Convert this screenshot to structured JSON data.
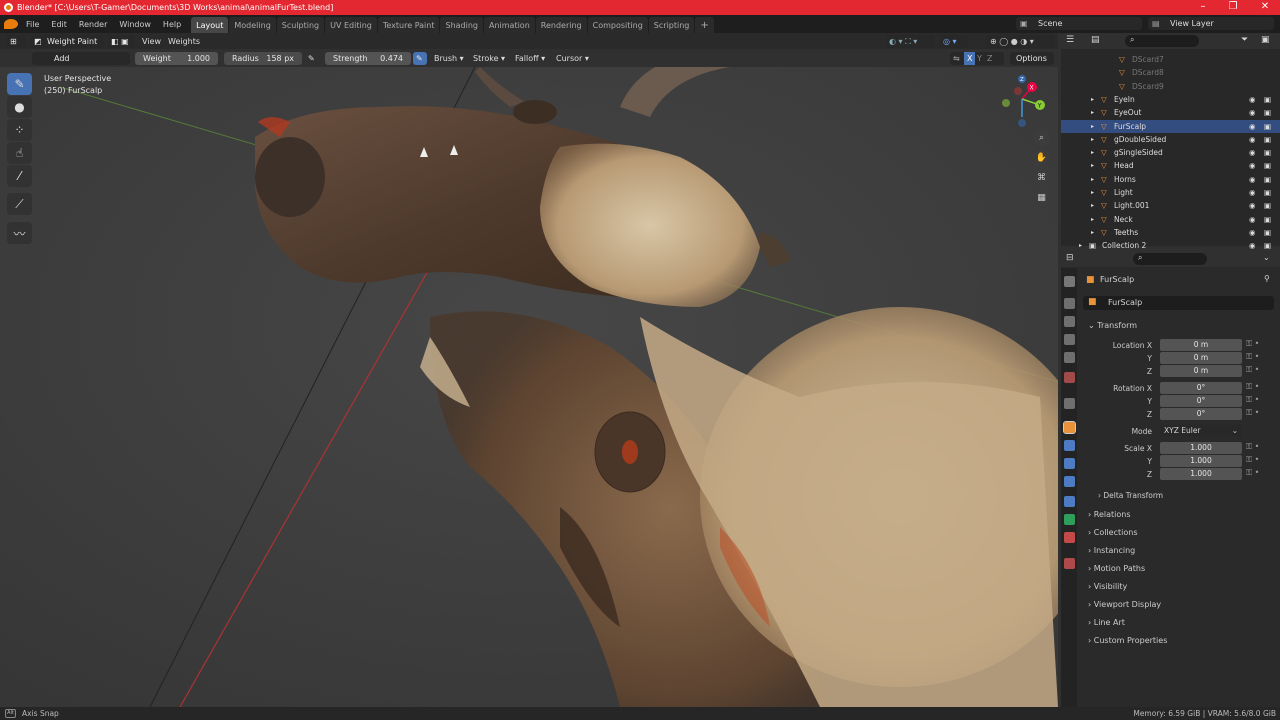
{
  "window": {
    "title": "Blender* [C:\\Users\\T-Gamer\\Documents\\3D Works\\animal\\animalFurTest.blend]",
    "minimize": "–",
    "maximize": "❐",
    "close": "✕"
  },
  "menu": [
    "File",
    "Edit",
    "Render",
    "Window",
    "Help"
  ],
  "workspaces": [
    "Layout",
    "Modeling",
    "Sculpting",
    "UV Editing",
    "Texture Paint",
    "Shading",
    "Animation",
    "Rendering",
    "Compositing",
    "Scripting"
  ],
  "add_workspace": "+",
  "scene": {
    "name": "Scene",
    "view_layer": "View Layer"
  },
  "header": {
    "mode": "Weight Paint",
    "view": "View",
    "weights": "Weights",
    "options": "Options"
  },
  "tool_settings": {
    "blend": "Add",
    "weight_label": "Weight",
    "weight_value": "1.000",
    "radius_label": "Radius",
    "radius_value": "158 px",
    "strength_label": "Strength",
    "strength_value": "0.474",
    "brush": "Brush",
    "stroke": "Stroke",
    "falloff": "Falloff",
    "cursor": "Cursor",
    "axis_x": "X",
    "axis_y": "Y",
    "axis_z": "Z"
  },
  "viewport": {
    "perspective": "User Perspective",
    "object": "(250) FurScalp"
  },
  "gizmo": {
    "x": "X",
    "y": "Y",
    "z": "Z"
  },
  "outliner": {
    "rows": [
      {
        "name": "DScard7",
        "faded": true,
        "indent": 2
      },
      {
        "name": "DScard8",
        "faded": true,
        "indent": 2
      },
      {
        "name": "DScard9",
        "faded": true,
        "indent": 2
      },
      {
        "name": "EyeIn",
        "indent": 1
      },
      {
        "name": "EyeOut",
        "indent": 1
      },
      {
        "name": "FurScalp",
        "indent": 1,
        "selected": true
      },
      {
        "name": "gDoubleSided",
        "indent": 1
      },
      {
        "name": "gSingleSided",
        "indent": 1
      },
      {
        "name": "Head",
        "indent": 1
      },
      {
        "name": "Horns",
        "indent": 1
      },
      {
        "name": "Light",
        "indent": 1
      },
      {
        "name": "Light.001",
        "indent": 1
      },
      {
        "name": "Neck",
        "indent": 1
      },
      {
        "name": "Teeths",
        "indent": 1
      },
      {
        "name": "Collection 2",
        "indent": 0
      }
    ]
  },
  "properties": {
    "object_name": "FurScalp",
    "object_field": "FurScalp",
    "transform": "Transform",
    "location_x_label": "Location X",
    "y_label": "Y",
    "z_label": "Z",
    "location": [
      "0 m",
      "0 m",
      "0 m"
    ],
    "rotation_x_label": "Rotation X",
    "rotation": [
      "0°",
      "0°",
      "0°"
    ],
    "mode_label": "Mode",
    "mode_value": "XYZ Euler",
    "scale_x_label": "Scale X",
    "scale": [
      "1.000",
      "1.000",
      "1.000"
    ],
    "delta_transform": "Delta Transform",
    "sections": [
      "Relations",
      "Collections",
      "Instancing",
      "Motion Paths",
      "Visibility",
      "Viewport Display",
      "Line Art",
      "Custom Properties"
    ]
  },
  "status": {
    "axis_snap": "Axis Snap",
    "memory": "Memory: 6.59 GiB | VRAM: 5.6/8.0 GiB"
  }
}
